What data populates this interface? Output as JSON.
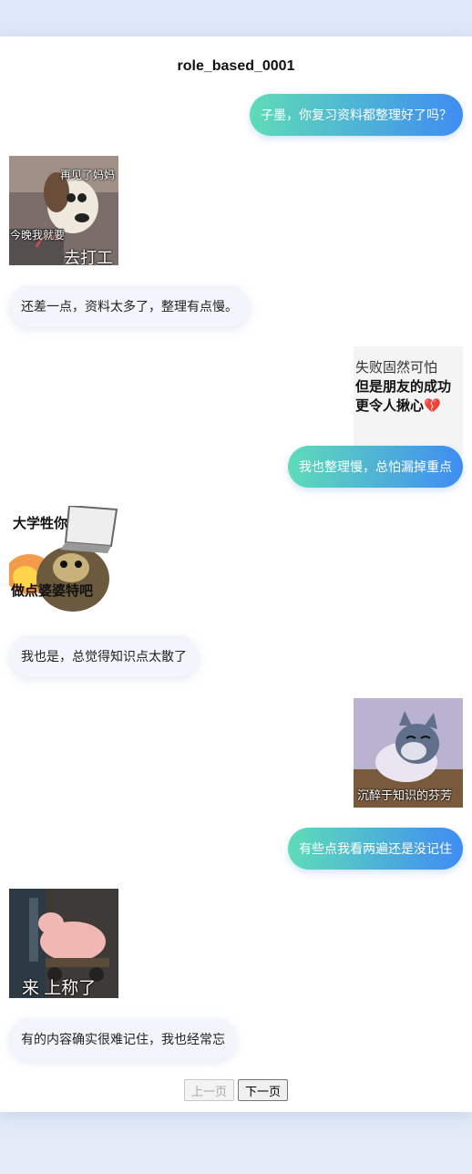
{
  "title": "role_based_0001",
  "messages": {
    "m1": "子墨，你复习资料都整理好了吗？",
    "m3": "还差一点，资料太多了，整理有点慢。",
    "m5": "我也整理慢，总怕漏掉重点",
    "m7": "我也是，总觉得知识点太散了",
    "m9": "有些点我看两遍还是没记住",
    "m11": "有的内容确实很难记住，我也经常忘"
  },
  "stickers": {
    "s1": {
      "top": "再见了妈妈",
      "mid": "今晚我就要",
      "bottom": "去打工"
    },
    "s2": {
      "line1": "失败固然可怕",
      "line2": "但是朋友的成功",
      "line3": "更令人揪心💔"
    },
    "s3": {
      "top": "大学牲你",
      "bottom": "做点婆婆特吧"
    },
    "s4": {
      "bottom": "沉醉于知识的芬芳"
    },
    "s5": {
      "bottom": "来 上称了"
    }
  },
  "pager": {
    "prev": "上一页",
    "next": "下一页"
  }
}
